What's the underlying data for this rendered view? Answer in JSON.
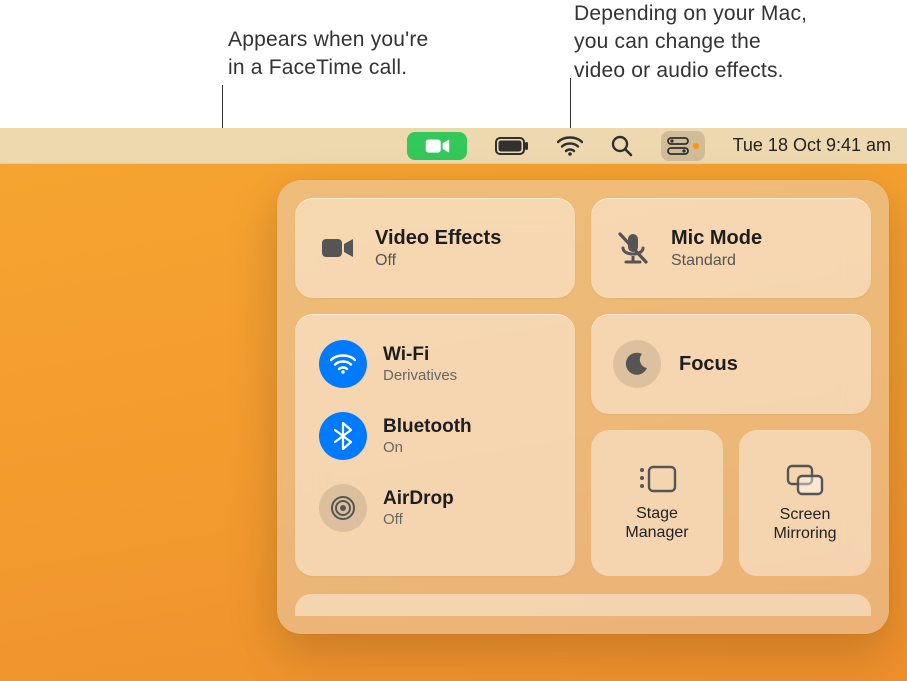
{
  "annotations": {
    "a1_l1": "Appears when you're",
    "a1_l2": "in a FaceTime call.",
    "a2_l1": "Depending on your Mac,",
    "a2_l2": "you can change the",
    "a2_l3": "video or audio effects."
  },
  "menubar": {
    "facetime_icon": "facetime",
    "battery_icon": "battery",
    "wifi_icon": "wifi",
    "search_icon": "search",
    "controlcenter_icon": "control-center",
    "indicator": "orange-dot",
    "datetime": "Tue 18 Oct  9:41 am"
  },
  "cc": {
    "video_effects": {
      "title": "Video Effects",
      "sub": "Off"
    },
    "mic_mode": {
      "title": "Mic Mode",
      "sub": "Standard"
    },
    "wifi": {
      "title": "Wi-Fi",
      "sub": "Derivatives"
    },
    "bluetooth": {
      "title": "Bluetooth",
      "sub": "On"
    },
    "airdrop": {
      "title": "AirDrop",
      "sub": "Off"
    },
    "focus": {
      "title": "Focus"
    },
    "stage": {
      "l1": "Stage",
      "l2": "Manager"
    },
    "mirror": {
      "l1": "Screen",
      "l2": "Mirroring"
    }
  },
  "colors": {
    "facetime_green": "#34c759",
    "accent_blue": "#007aff",
    "indicator_orange": "#ff9500"
  }
}
